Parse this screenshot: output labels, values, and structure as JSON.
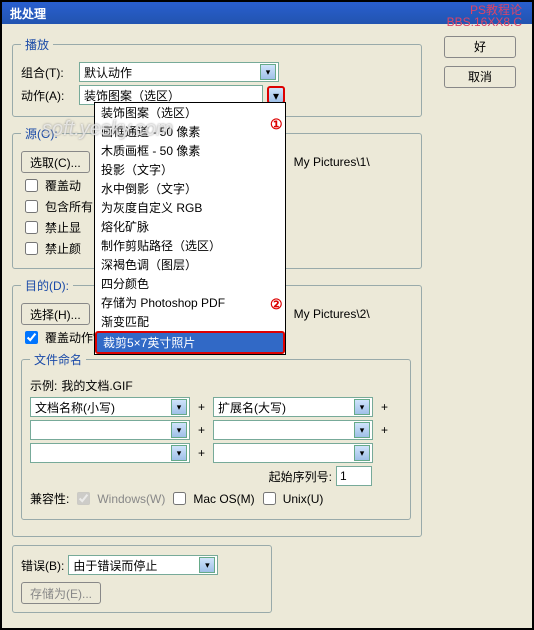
{
  "title": "批处理",
  "watermark": {
    "l1": "PS教程论",
    "l2": "BBS.16XX8.C"
  },
  "softwm": "soft.yesky.com",
  "buttons": {
    "ok": "好",
    "cancel": "取消"
  },
  "play": {
    "legend": "播放",
    "set_label": "组合(T):",
    "set_value": "默认动作",
    "action_label": "动作(A):",
    "action_value": "装饰图案（选区）",
    "options": [
      "装饰图案（选区）",
      "画框通道 - 50 像素",
      "木质画框 - 50 像素",
      "投影（文字）",
      "水中倒影（文字）",
      "为灰度自定义 RGB",
      "熔化矿脉",
      "制作剪贴路径（选区）",
      "深褐色调（图层）",
      "四分颜色",
      "存储为 Photoshop PDF",
      "渐变匹配",
      "裁剪5×7英寸照片"
    ]
  },
  "source": {
    "legend": "源(O):",
    "choose": "选取(C)...",
    "path_suffix": "My Pictures\\1\\",
    "c1": "覆盖动",
    "c2": "包含所有",
    "c3": "禁止显",
    "c4": "禁止颜"
  },
  "dest": {
    "legend": "目的(D):",
    "choose": "选择(H)...",
    "path_suffix": "My Pictures\\2\\",
    "override": "覆盖动作\"存储为\"命令(V)"
  },
  "naming": {
    "legend": "文件命名",
    "example_label": "示例:",
    "example_value": "我的文档.GIF",
    "f1": "文档名称(小写)",
    "f2": "扩展名(大写)",
    "start_label": "起始序列号:",
    "start_value": "1",
    "compat_label": "兼容性:",
    "win": "Windows(W)",
    "mac": "Mac OS(M)",
    "unix": "Unix(U)"
  },
  "error": {
    "label": "错误(B):",
    "value": "由于错误而停止",
    "save_as": "存储为(E)..."
  },
  "anno": {
    "a1": "①",
    "a2": "②"
  }
}
